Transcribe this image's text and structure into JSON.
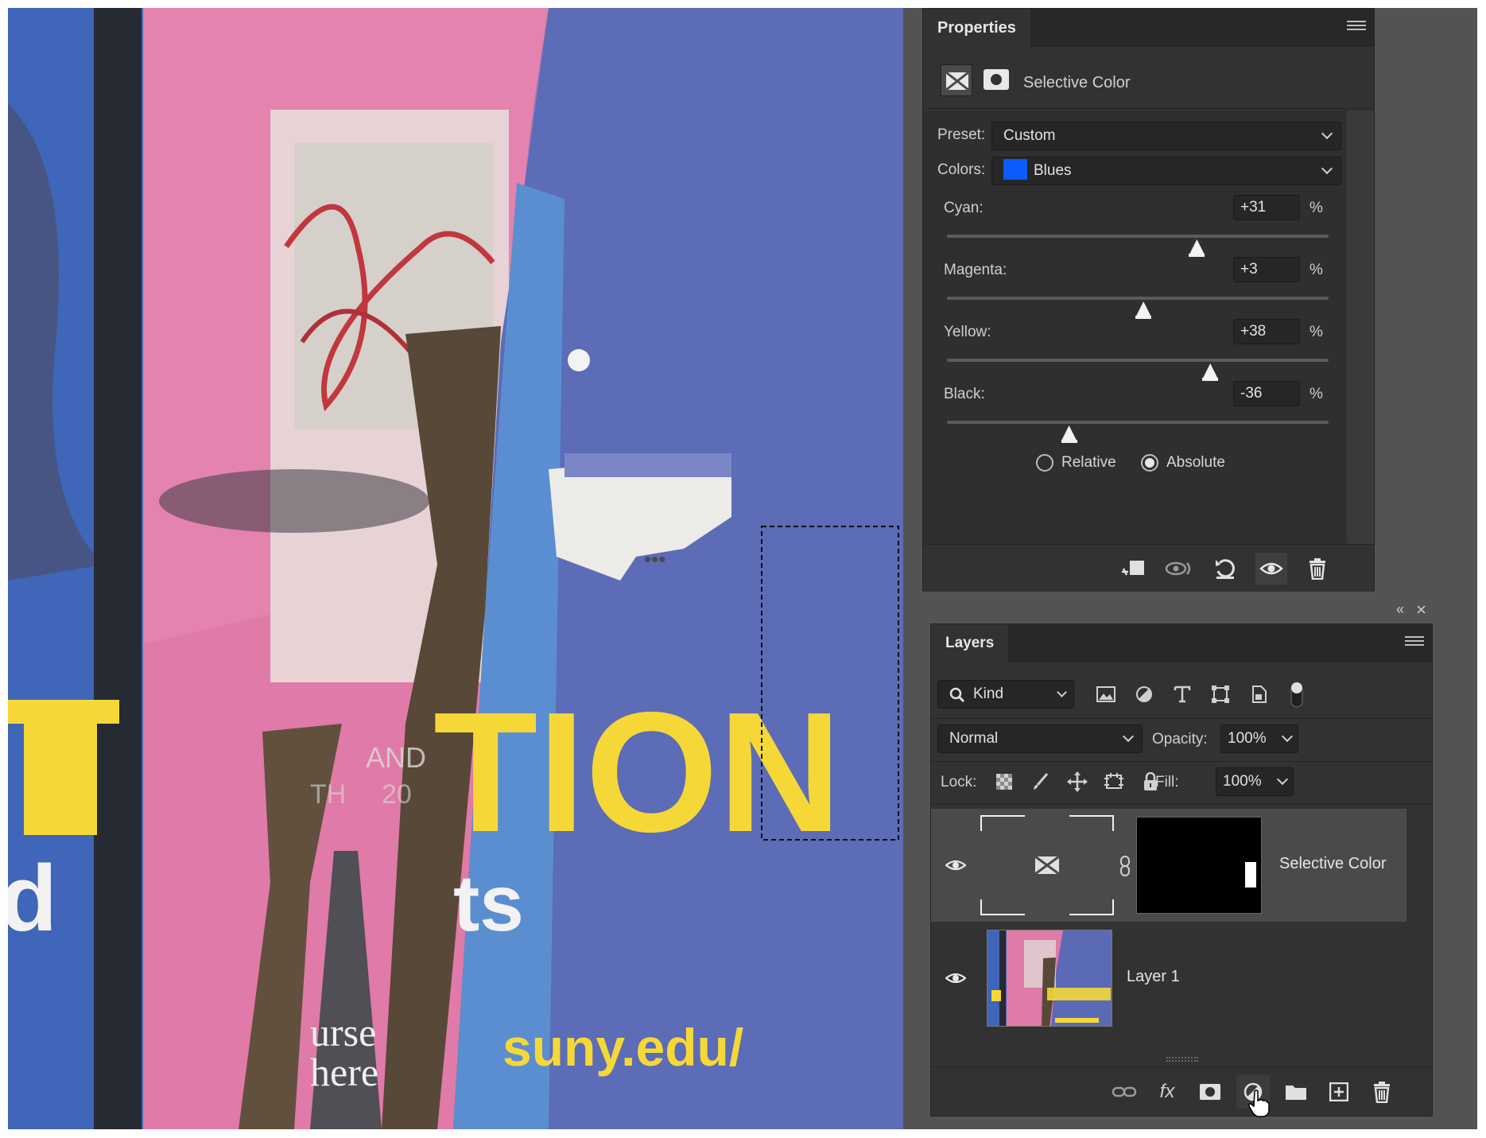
{
  "properties": {
    "tab": "Properties",
    "adjustment_title": "Selective Color",
    "preset_label": "Preset:",
    "preset_value": "Custom",
    "colors_label": "Colors:",
    "colors_value": "Blues",
    "colors_swatch": "#0a5cff",
    "sliders": [
      {
        "label": "Cyan:",
        "value": "+31",
        "unit": "%",
        "percent": 31
      },
      {
        "label": "Magenta:",
        "value": "+3",
        "unit": "%",
        "percent": 3
      },
      {
        "label": "Yellow:",
        "value": "+38",
        "unit": "%",
        "percent": 38
      },
      {
        "label": "Black:",
        "value": "-36",
        "unit": "%",
        "percent": -36
      }
    ],
    "method": [
      {
        "label": "Relative",
        "selected": false
      },
      {
        "label": "Absolute",
        "selected": true
      }
    ],
    "footer_icons": [
      "clip-to-layer-icon",
      "view-previous-icon",
      "reset-icon",
      "visibility-icon",
      "delete-icon"
    ]
  },
  "layers": {
    "tab": "Layers",
    "filter_kind": "Kind",
    "blend_mode": "Normal",
    "opacity_label": "Opacity:",
    "opacity_value": "100%",
    "lock_label": "Lock:",
    "fill_label": "Fill:",
    "fill_value": "100%",
    "items": [
      {
        "name": "Selective Color",
        "visible": true,
        "selected": true
      },
      {
        "name": "Layer 1",
        "visible": true,
        "selected": false
      }
    ],
    "footer_icons": [
      "link-layers-icon",
      "fx-icon",
      "add-mask-icon",
      "new-adjustment-layer-icon",
      "new-group-icon",
      "new-layer-icon",
      "delete-layer-icon"
    ],
    "fx_label": "fx"
  },
  "canvas": {
    "poster_text_large": "TION",
    "poster_text_left": "d",
    "poster_text_mid": "ts",
    "poster_url": "suny.edu/",
    "poster_small_1": "AND",
    "poster_small_2": "TH",
    "poster_small_3": "20",
    "poster_small_4": "urse",
    "poster_small_5": "here",
    "poster_dots": "•••"
  },
  "colors": {
    "panel_bg": "#323232",
    "panel_dark": "#262626",
    "app_bg": "#535353",
    "poster_blue": "#5a6ab4",
    "poster_pink": "#e07aa8",
    "poster_yellow": "#f5d838"
  }
}
